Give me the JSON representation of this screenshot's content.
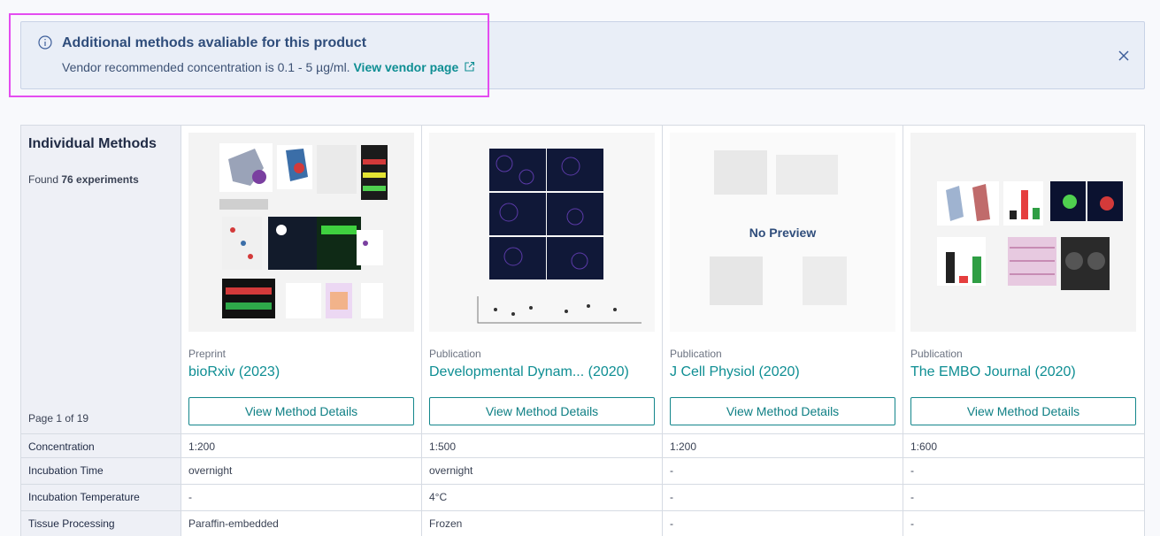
{
  "banner": {
    "title": "Additional methods avaliable for this product",
    "desc_prefix": "Vendor recommended concentration is 0.1 - 5 µg/ml.",
    "link": "View vendor page"
  },
  "table": {
    "heading": "Individual Methods",
    "found_prefix": "Found",
    "found_count": "76 experiments",
    "page": "Page 1 of 19",
    "cards": [
      {
        "kind": "Preprint",
        "title": "bioRxiv (2023)",
        "button": "View Method Details",
        "preview": ""
      },
      {
        "kind": "Publication",
        "title": "Developmental Dynam... (2020)",
        "button": "View Method Details",
        "preview": ""
      },
      {
        "kind": "Publication",
        "title": "J Cell Physiol (2020)",
        "button": "View Method Details",
        "preview": "No Preview"
      },
      {
        "kind": "Publication",
        "title": "The EMBO Journal (2020)",
        "button": "View Method Details",
        "preview": ""
      }
    ],
    "rows": [
      {
        "label": "Concentration",
        "values": [
          "1:200",
          "1:500",
          "1:200",
          "1:600"
        ]
      },
      {
        "label": "Incubation Time",
        "values": [
          "overnight",
          "overnight",
          "-",
          "-"
        ]
      },
      {
        "label": "Incubation Temperature",
        "values": [
          "-",
          "4°C",
          "-",
          "-"
        ]
      },
      {
        "label": "Tissue Processing",
        "values": [
          "Paraffin-embedded",
          "Frozen",
          "-",
          "-"
        ]
      }
    ]
  },
  "colors": {
    "accent": "#0e8e93",
    "highlight": "#e44cf0",
    "banner_bg": "#e9eef7"
  }
}
